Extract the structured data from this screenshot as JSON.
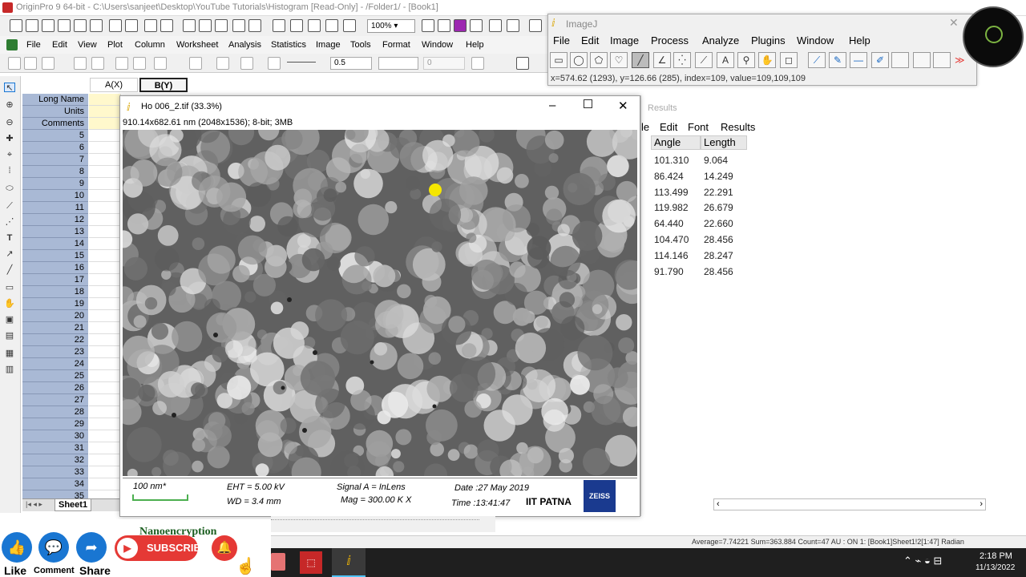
{
  "origin": {
    "title": "OriginPro 9 64-bit - C:\\Users\\sanjeet\\Desktop\\YouTube Tutorials\\Histogram [Read-Only] - /Folder1/ - [Book1]",
    "zoom": "100%",
    "menu": [
      "File",
      "Edit",
      "View",
      "Plot",
      "Column",
      "Worksheet",
      "Analysis",
      "Statistics",
      "Image",
      "Tools",
      "Format",
      "Window",
      "Help"
    ],
    "line_width": "0.5",
    "fill_value": "0"
  },
  "worksheet": {
    "col_a": "A(X)",
    "col_b": "B(Y)",
    "meta_rows": [
      "Long Name",
      "Units",
      "Comments"
    ],
    "rows": [
      "5",
      "6",
      "7",
      "8",
      "9",
      "10",
      "11",
      "12",
      "13",
      "14",
      "15",
      "16",
      "17",
      "18",
      "19",
      "20",
      "21",
      "22",
      "23",
      "24",
      "25",
      "26",
      "27",
      "28",
      "29",
      "30",
      "31",
      "32",
      "33",
      "34",
      "35"
    ],
    "sheet_tab": "Sheet1"
  },
  "image_window": {
    "title": "Ho 006_2.tif (33.3%)",
    "info": "910.14x682.61 nm (2048x1536); 8-bit; 3MB",
    "footer": {
      "scale": "100 nm*",
      "eht": "EHT =  5.00 kV",
      "wd": "WD =  3.4 mm",
      "signal": "Signal A = InLens",
      "mag": "Mag =  300.00 K X",
      "date": "Date :27 May 2019",
      "time": "Time :13:41:47",
      "institute": "IIT PATNA",
      "brand": "ZEISS"
    }
  },
  "imagej": {
    "title": "ImageJ",
    "menu": [
      "File",
      "Edit",
      "Image",
      "Process",
      "Analyze",
      "Plugins",
      "Window",
      "Help"
    ],
    "status": "x=574.62 (1293), y=126.66 (285), index=109, value=109,109,109"
  },
  "results": {
    "title": "Results",
    "menu": [
      "le",
      "Edit",
      "Font",
      "Results"
    ],
    "headers": [
      "Angle",
      "Length"
    ],
    "rows": [
      [
        "101.310",
        "9.064"
      ],
      [
        "86.424",
        "14.249"
      ],
      [
        "113.499",
        "22.291"
      ],
      [
        "119.982",
        "26.679"
      ],
      [
        "64.440",
        "22.660"
      ],
      [
        "104.470",
        "28.456"
      ],
      [
        "114.146",
        "28.247"
      ],
      [
        "91.790",
        "28.456"
      ]
    ]
  },
  "status_bar": "Average=7.74221 Sum=363.884 Count=47  AU : ON     1: [Book1]Sheet1!2[1:47]  Radian",
  "taskbar": {
    "time": "2:18 PM",
    "date": "11/13/2022"
  },
  "social": {
    "channel": "Nanoencryption",
    "like": "Like",
    "comment": "Comment",
    "share": "Share",
    "subscribe": "SUBSCRIBE"
  },
  "colors": {
    "accent": "#1976d2",
    "subscribe": "#e53935",
    "row_header": "#a9b9d5",
    "marker": "#f5e600"
  }
}
